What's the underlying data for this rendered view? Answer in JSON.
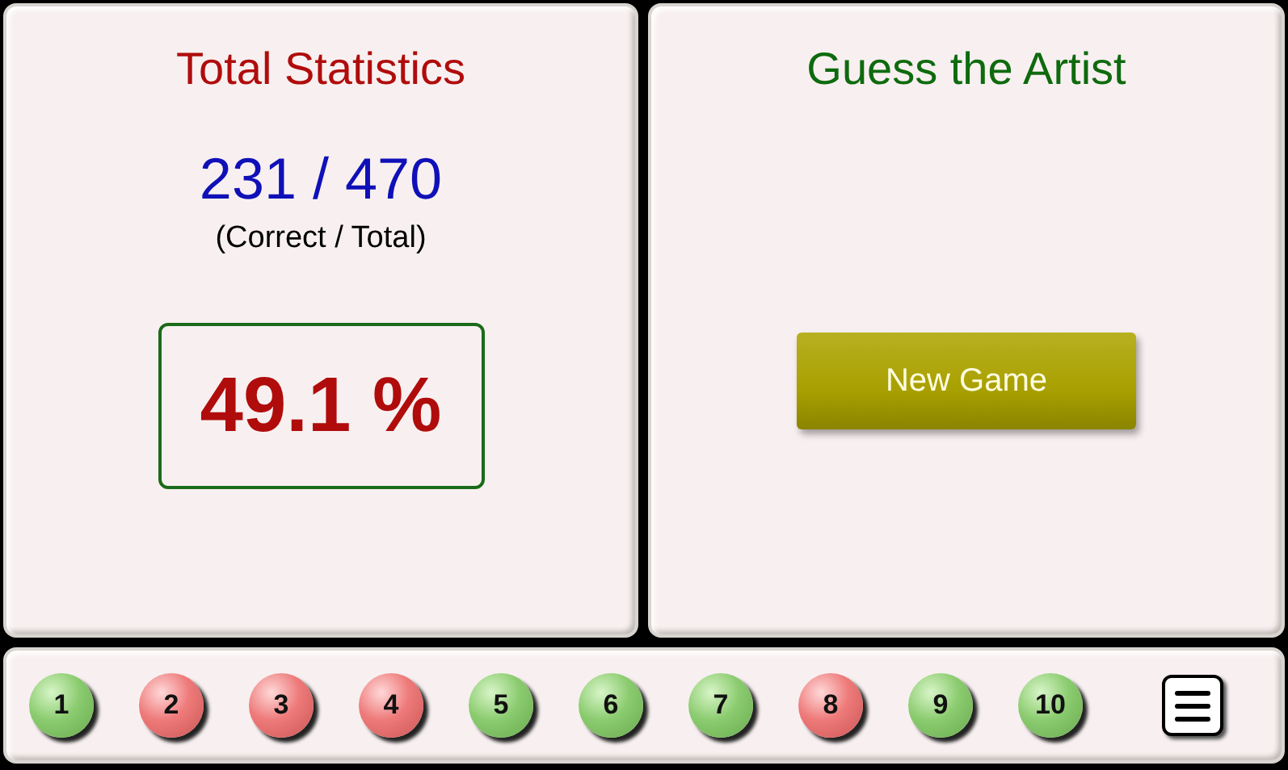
{
  "statistics": {
    "title": "Total Statistics",
    "score": "231 / 470",
    "score_caption": "(Correct / Total)",
    "percentage": "49.1 %"
  },
  "game": {
    "title": "Guess the Artist",
    "button": "New Game"
  },
  "questions": [
    {
      "label": "1",
      "correct": true
    },
    {
      "label": "2",
      "correct": false
    },
    {
      "label": "3",
      "correct": false
    },
    {
      "label": "4",
      "correct": false
    },
    {
      "label": "5",
      "correct": true
    },
    {
      "label": "6",
      "correct": true
    },
    {
      "label": "7",
      "correct": true
    },
    {
      "label": "8",
      "correct": false
    },
    {
      "label": "9",
      "correct": true
    },
    {
      "label": "10",
      "correct": true
    }
  ]
}
